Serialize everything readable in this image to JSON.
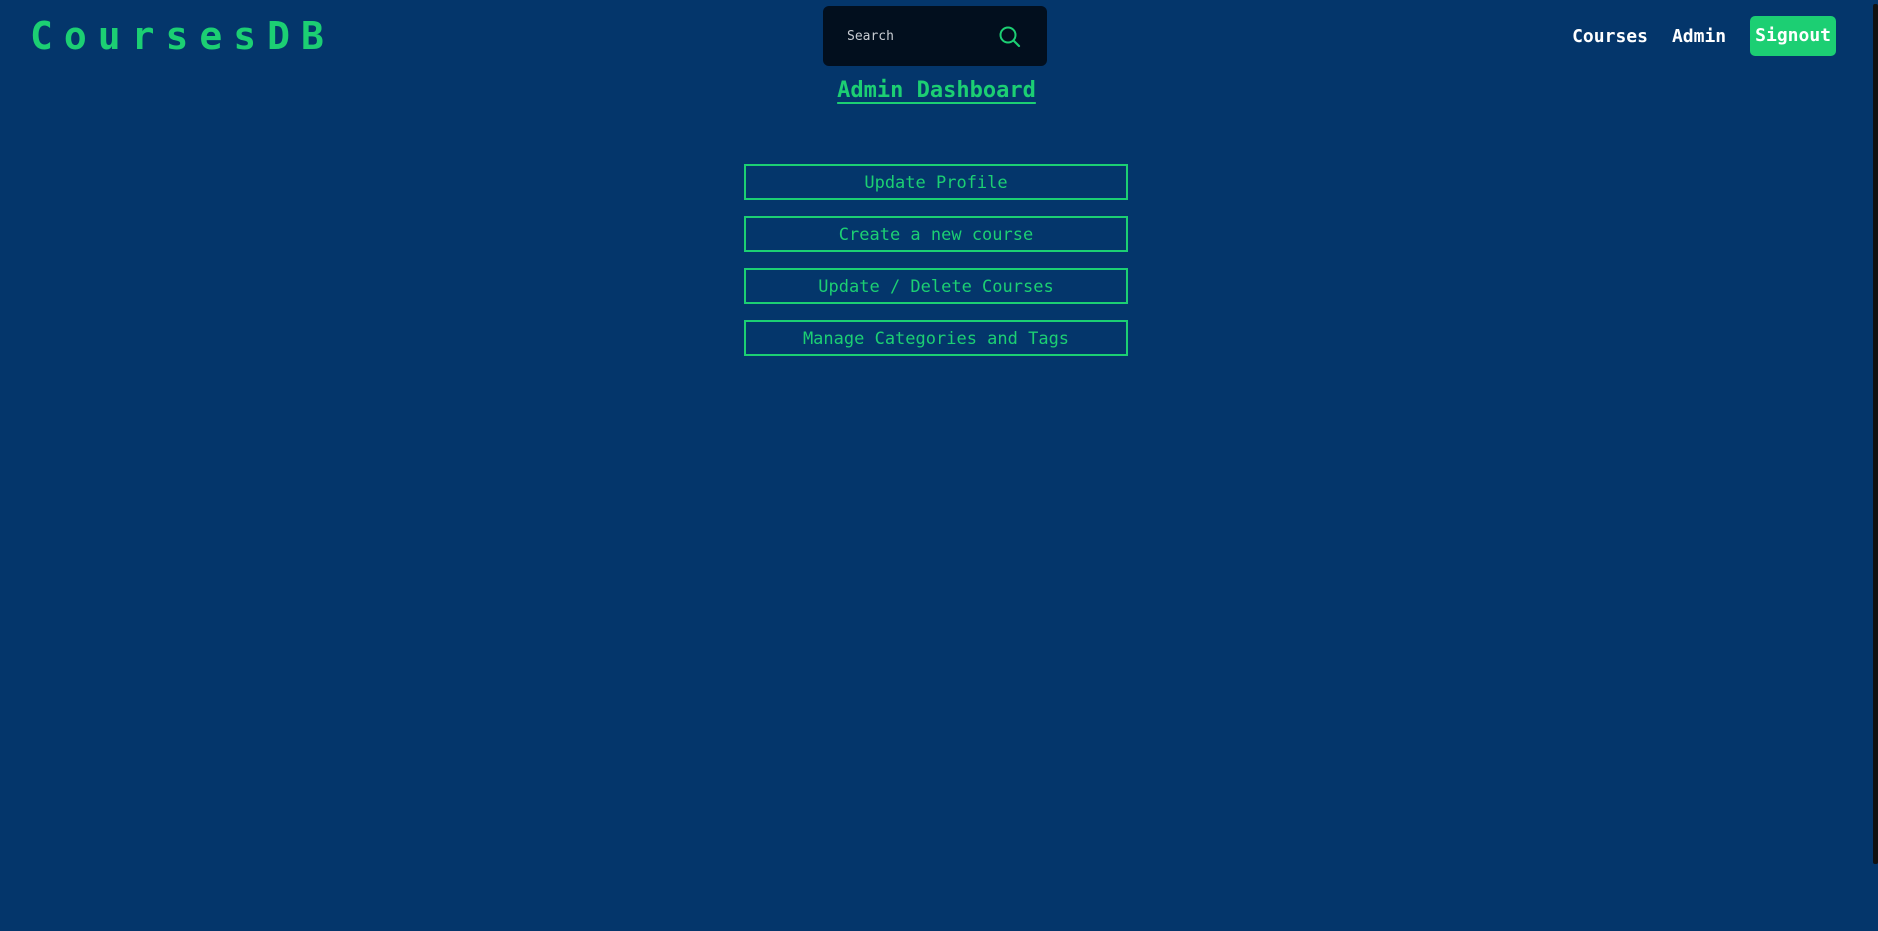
{
  "header": {
    "brand": "CoursesDB",
    "search": {
      "placeholder": "Search",
      "value": ""
    },
    "nav": {
      "courses": "Courses",
      "admin": "Admin",
      "signout": "Signout"
    }
  },
  "main": {
    "title": "Admin Dashboard",
    "actions": [
      {
        "label": "Update Profile"
      },
      {
        "label": "Create a new course"
      },
      {
        "label": "Update / Delete Courses"
      },
      {
        "label": "Manage Categories and Tags"
      }
    ]
  },
  "colors": {
    "background": "#04366b",
    "accent": "#1ccf73",
    "search_bg": "#020f1e",
    "nav_text": "#ffffff"
  },
  "icons": {
    "search": "search-icon"
  }
}
